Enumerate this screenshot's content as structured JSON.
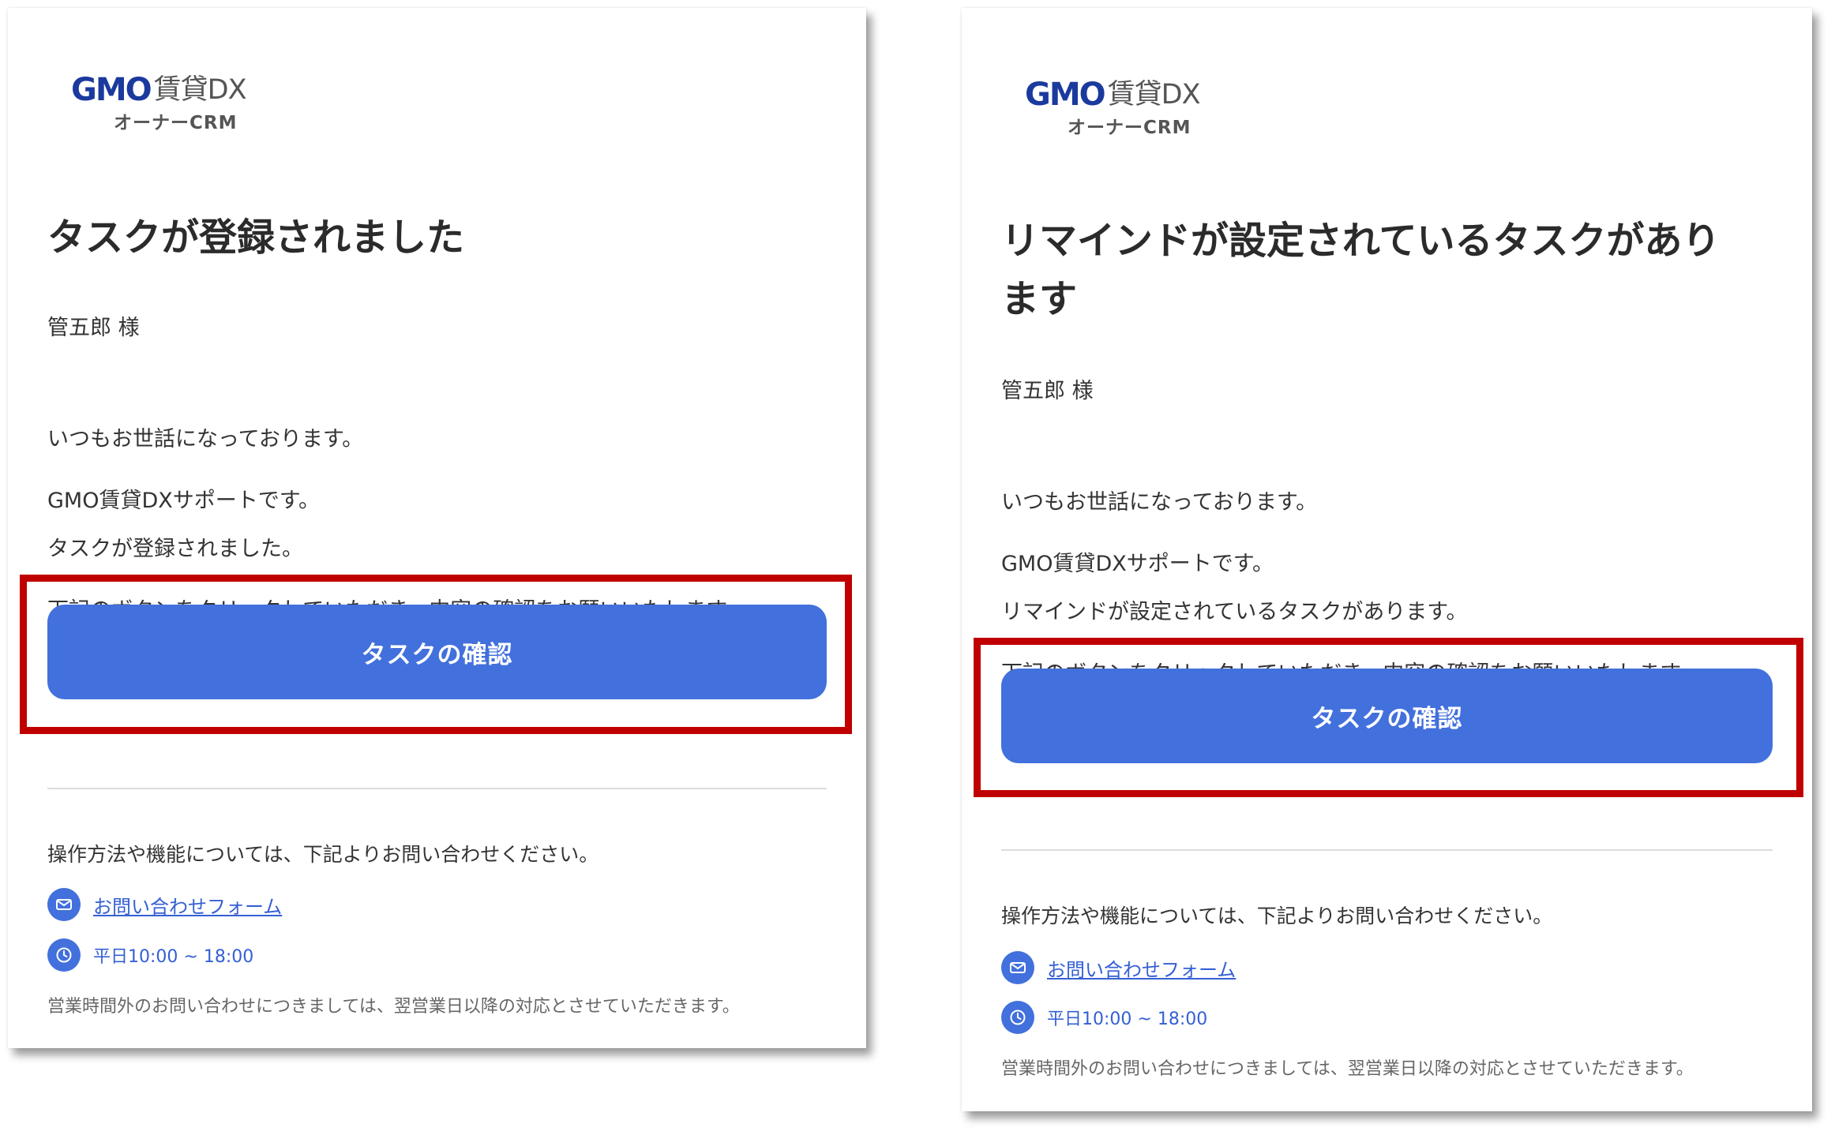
{
  "emails": [
    {
      "logo": {
        "brand": "GMO",
        "product": "賃貸DX",
        "sub": "オーナーCRM"
      },
      "title_lines": [
        "タスクが登録されました"
      ],
      "recipient": "管五郎 様",
      "greeting_lines": [
        "いつもお世話になっております。",
        "GMO賃貸DXサポートです。"
      ],
      "body_lines": [
        "タスクが登録されました。",
        "下記のボタンをクリックしていただき、内容の確認をお願いいたします。"
      ],
      "button_label": "タスクの確認",
      "footer_intro": "操作方法や機能については、下記よりお問い合わせください。",
      "contact_form_label": "お問い合わせフォーム",
      "hours": "平日10:00 ~ 18:00",
      "note": "営業時間外のお問い合わせにつきましては、翌営業日以降の対応とさせていただきます。"
    },
    {
      "logo": {
        "brand": "GMO",
        "product": "賃貸DX",
        "sub": "オーナーCRM"
      },
      "title_lines": [
        "リマインドが設定されているタスクがあり",
        "ます"
      ],
      "recipient": "管五郎 様",
      "greeting_lines": [
        "いつもお世話になっております。",
        "GMO賃貸DXサポートです。"
      ],
      "body_lines": [
        "リマインドが設定されているタスクがあります。",
        "下記のボタンをクリックしていただき、内容の確認をお願いいたします。"
      ],
      "button_label": "タスクの確認",
      "footer_intro": "操作方法や機能については、下記よりお問い合わせください。",
      "contact_form_label": "お問い合わせフォーム",
      "hours": "平日10:00 ~ 18:00",
      "note": "営業時間外のお問い合わせにつきましては、翌営業日以降の対応とさせていただきます。"
    }
  ],
  "colors": {
    "button": "#4270dc",
    "highlight": "#c00000",
    "link": "#3560d4",
    "logo_brand": "#1b3a9e"
  },
  "icons": [
    "mail-icon",
    "clock-icon"
  ]
}
